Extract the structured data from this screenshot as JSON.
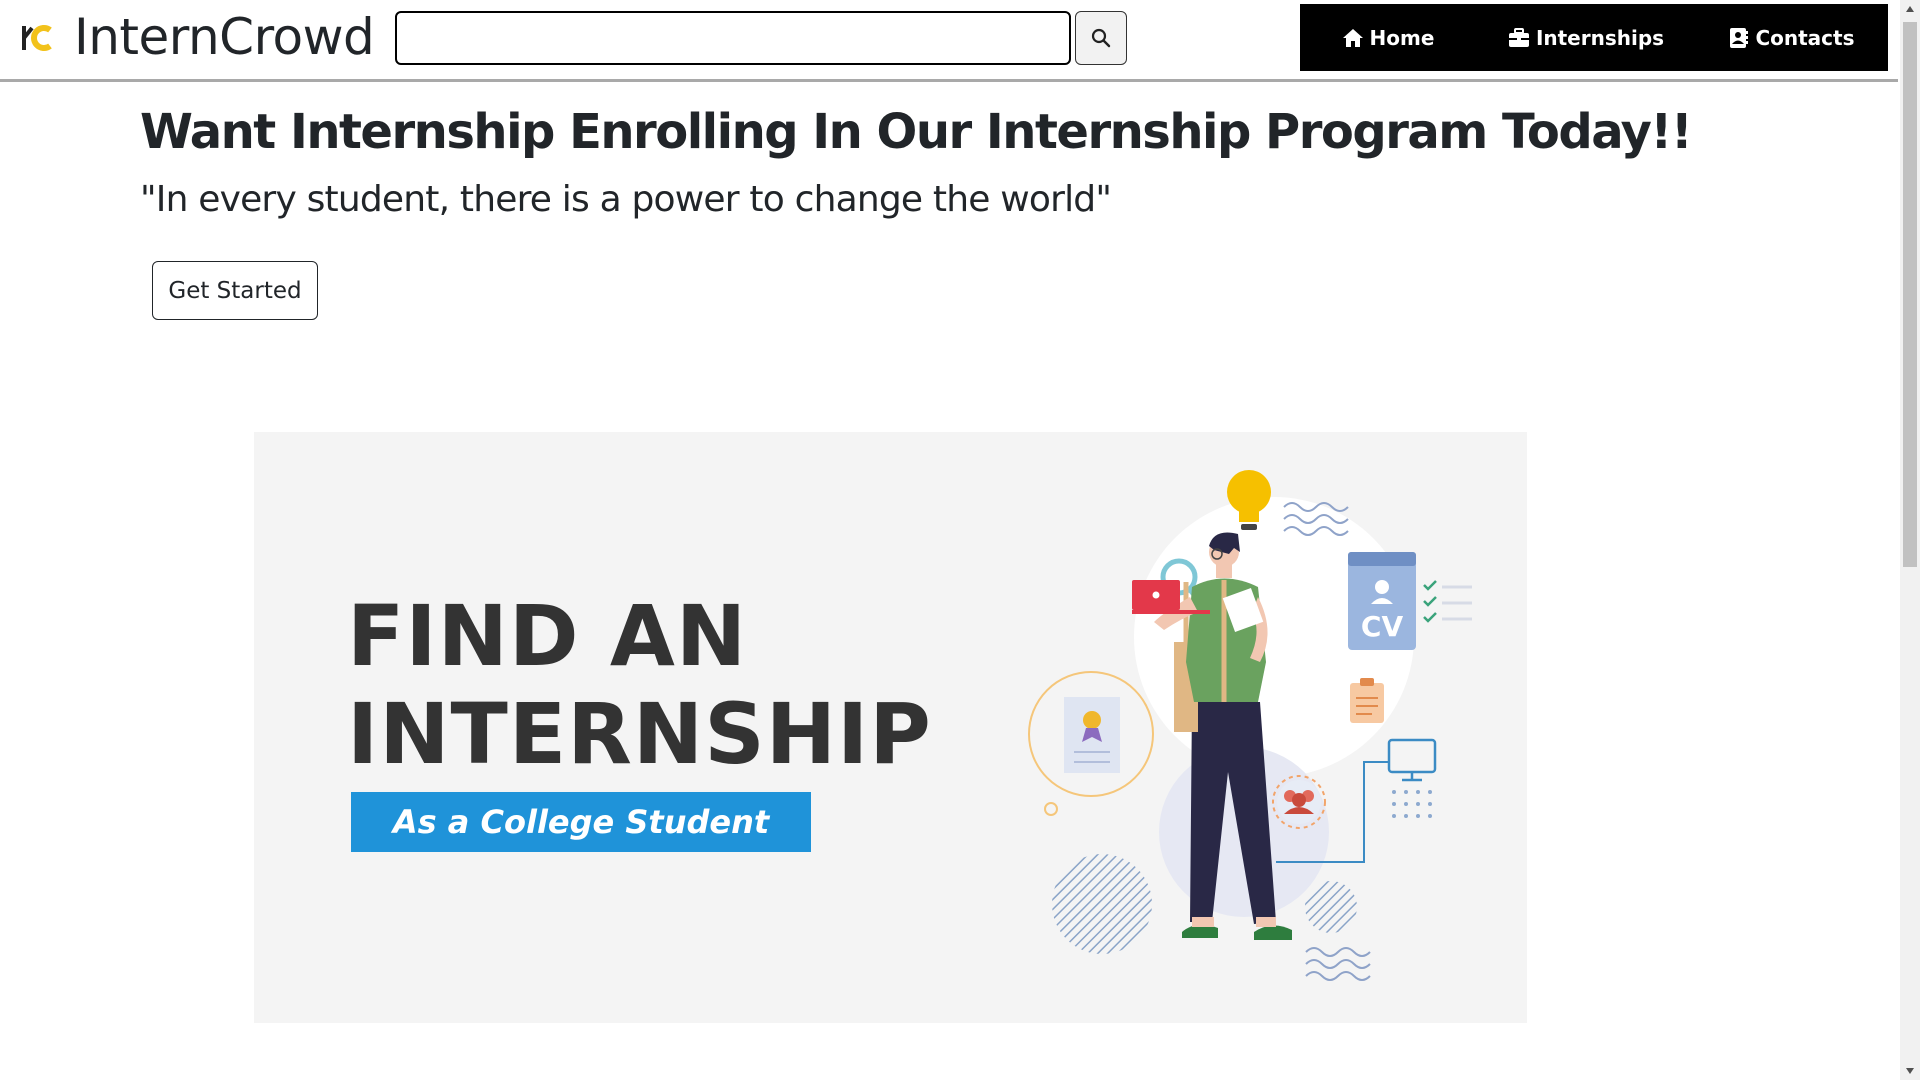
{
  "header": {
    "brand": "InternCrowd",
    "search": {
      "value": "",
      "placeholder": ""
    },
    "nav": {
      "home_label": "Home",
      "internships_label": "Internships",
      "contacts_label": "Contacts"
    }
  },
  "main": {
    "title": "Want Internship Enrolling In Our Internship Program Today!!",
    "quote": "\"In every student, there is a power to change the world\"",
    "cta_label": "Get Started"
  },
  "banner": {
    "headline_line1": "FIND AN",
    "headline_line2": "INTERNSHIP",
    "subtitle": "As a College Student",
    "cv_label": "CV"
  },
  "colors": {
    "nav_bg": "#000000",
    "banner_accent": "#1f93d9",
    "banner_bg": "#f4f4f4",
    "logo_yellow": "#f2c21b"
  },
  "icons": {
    "logo": "interncrowd-logo-icon",
    "search": "search-icon",
    "home": "home-icon",
    "internships": "briefcase-icon",
    "contacts": "contact-card-icon"
  }
}
